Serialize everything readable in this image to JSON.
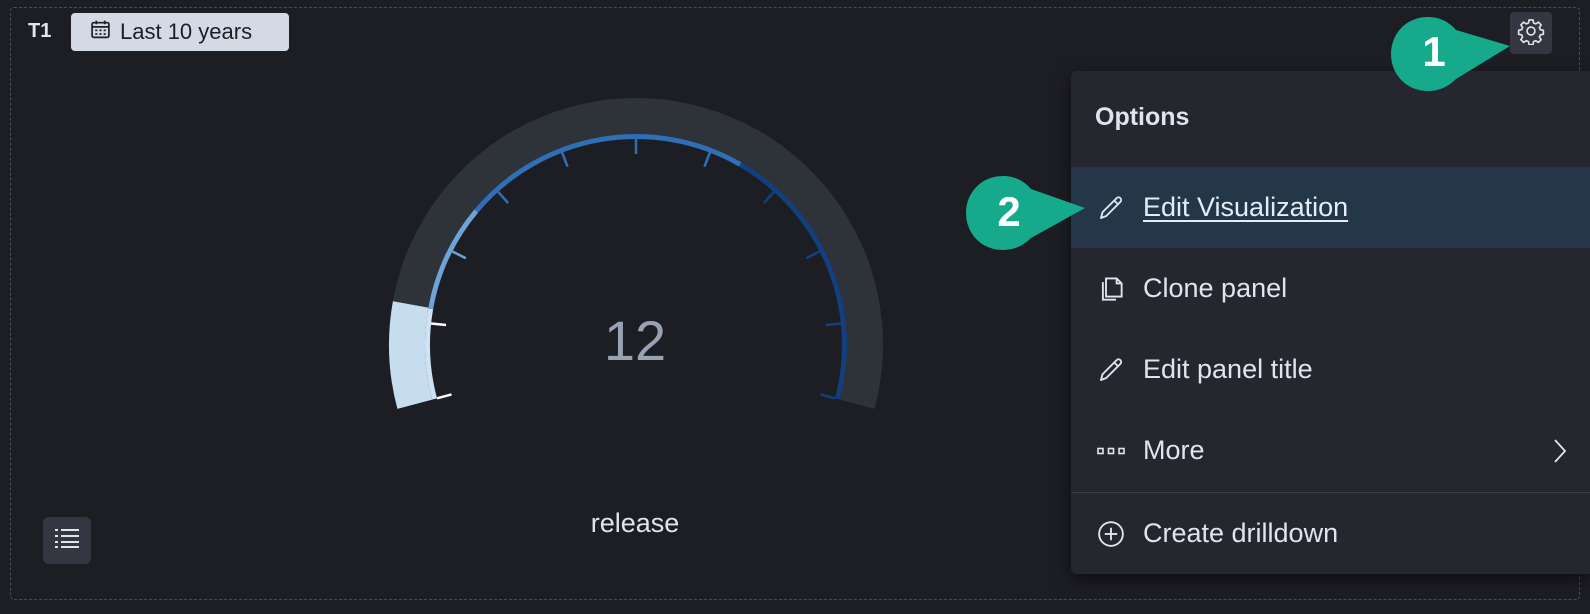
{
  "panel": {
    "title": "T1",
    "time_range": "Last 10 years"
  },
  "gauge": {
    "value": "12",
    "label": "release",
    "fill_fraction": 0.12,
    "colors": {
      "track": "#2e3239",
      "fill": "#c6dcef",
      "band_light": "#cfe2f3",
      "band_mid": "#6da3d6",
      "band_blue": "#2f6fb5",
      "band_dark": "#143f7e"
    }
  },
  "menu": {
    "title": "Options",
    "items": [
      {
        "label": "Edit Visualization",
        "icon": "pencil-icon"
      },
      {
        "label": "Clone panel",
        "icon": "copy-icon"
      },
      {
        "label": "Edit panel title",
        "icon": "pencil-icon"
      },
      {
        "label": "More",
        "icon": "ellipsis-icon"
      },
      {
        "label": "Create drilldown",
        "icon": "plus-circle-icon"
      }
    ]
  },
  "callouts": [
    {
      "number": "1"
    },
    {
      "number": "2"
    }
  ],
  "colors": {
    "background": "#1d1e24",
    "menu_bg": "#25262e",
    "menu_active": "#233749",
    "callout": "#16a98c",
    "badge_bg": "#d4dae5"
  }
}
